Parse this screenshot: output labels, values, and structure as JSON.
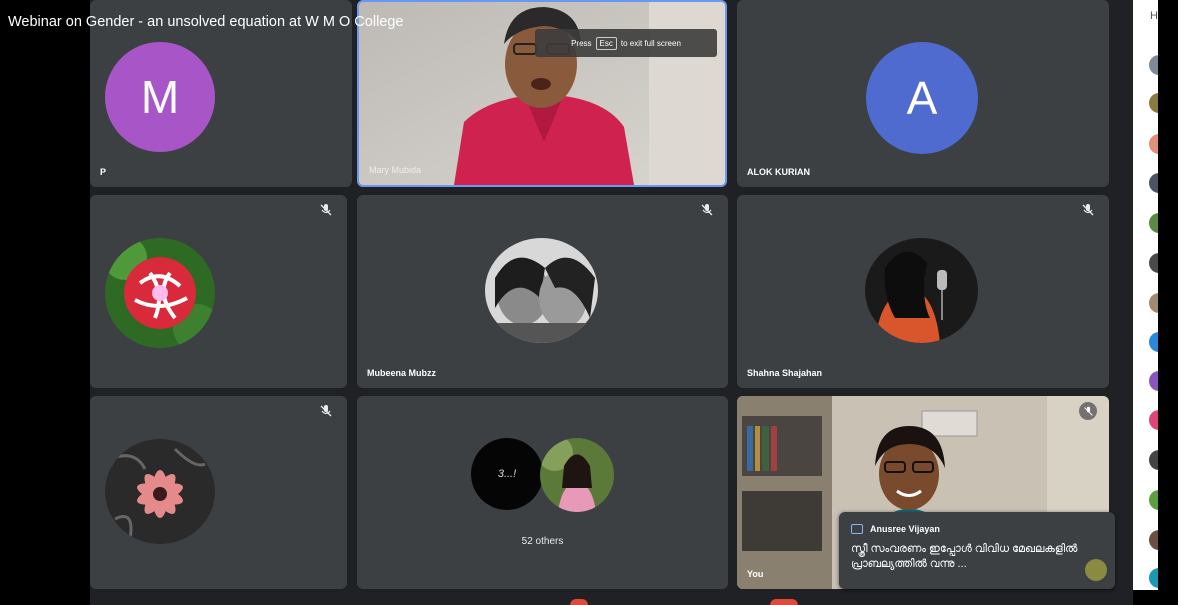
{
  "window": {
    "title": "Webinar on Gender - an unsolved equation at W M O College"
  },
  "fullscreen_banner": {
    "press": "Press",
    "key": "Esc",
    "suffix": "to exit full screen"
  },
  "tiles": {
    "m_tile": {
      "initial": "M",
      "name": "P",
      "color": "#a855c8"
    },
    "presenter": {
      "name": "Mary Mubida"
    },
    "alok": {
      "initial": "A",
      "name": "ALOK KURIAN",
      "color": "#4f6bd0"
    },
    "rose": {
      "name": ""
    },
    "mubeena": {
      "name": "Mubeena Mubzz"
    },
    "shahna": {
      "name": "Shahna Shajahan"
    },
    "flower": {
      "name": ""
    },
    "others": {
      "label": "52 others",
      "initial_text": "3...!"
    },
    "you": {
      "name": "You"
    }
  },
  "chat_popup": {
    "sender": "Anusree Vijayan",
    "message": "സ്ത്രീ സംവരണം ഇപ്പോൾ വിവിധ മേഖലകളിൽ പ്രാബല്യത്തിൽ വന്നു ..."
  },
  "colors": {
    "tile_bg": "#3c4043",
    "grid_bg": "#202124",
    "active_border": "#6a98f0"
  }
}
